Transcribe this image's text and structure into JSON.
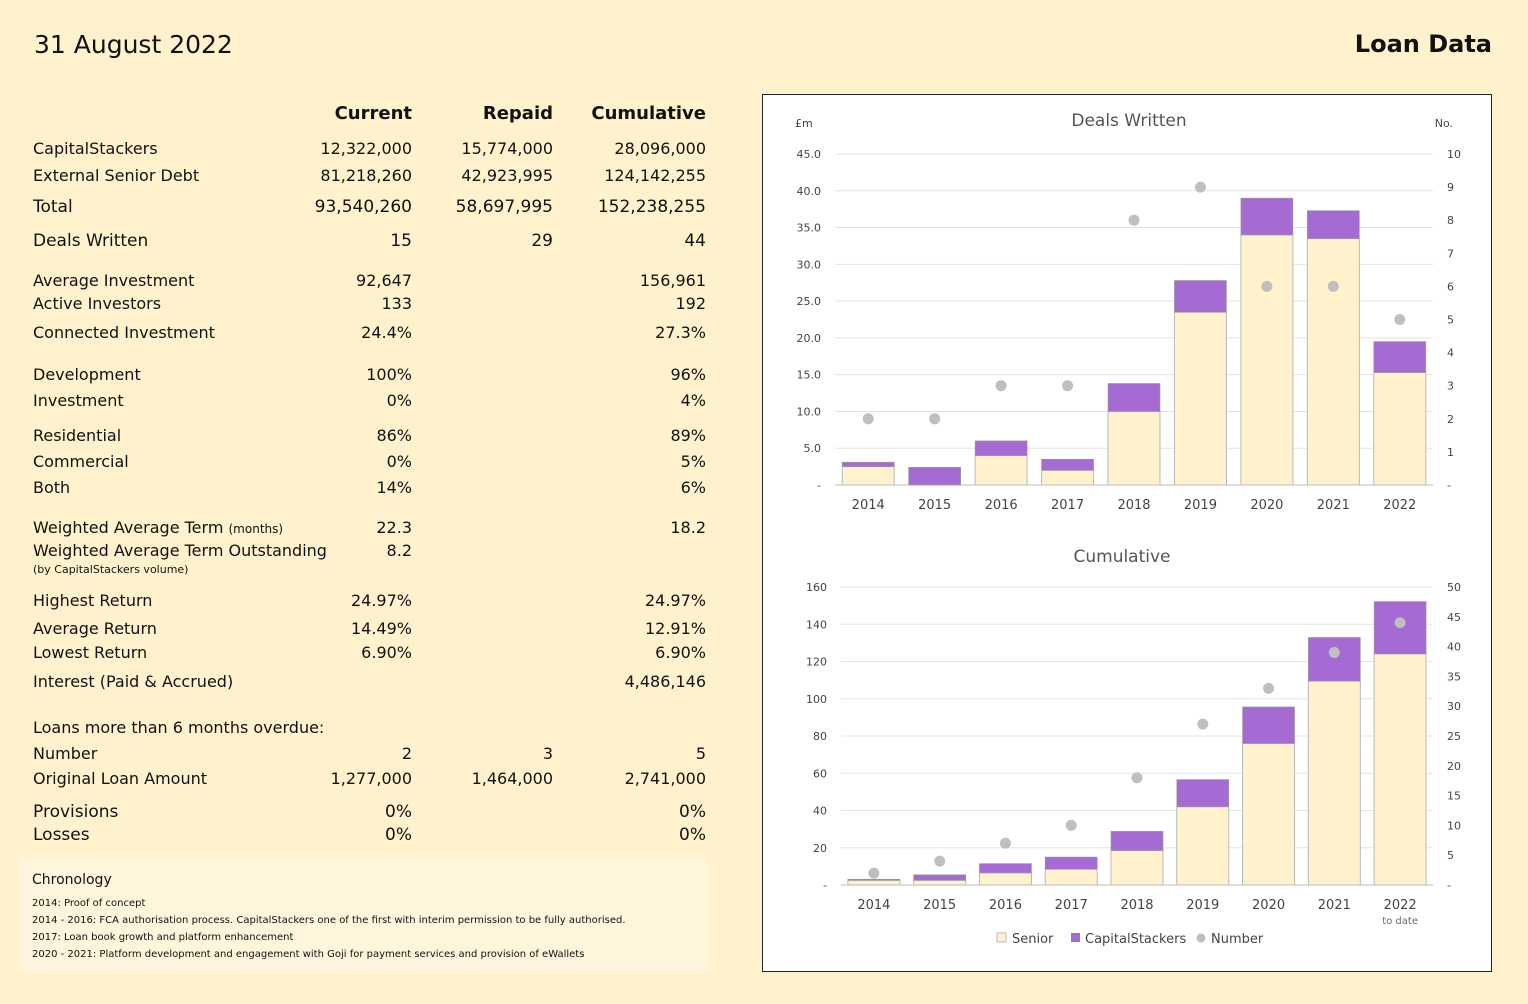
{
  "header": {
    "date": "31 August 2022",
    "title": "Loan Data"
  },
  "columns": {
    "current": "Current",
    "repaid": "Repaid",
    "cumulative": "Cumulative"
  },
  "rows": [
    {
      "label": "CapitalStackers",
      "current": "12,322,000",
      "repaid": "15,774,000",
      "cumulative": "28,096,000"
    },
    {
      "label": "External Senior Debt",
      "current": "81,218,260",
      "repaid": "42,923,995",
      "cumulative": "124,142,255"
    },
    {
      "label": "Total",
      "current": "93,540,260",
      "repaid": "58,697,995",
      "cumulative": "152,238,255"
    },
    {
      "label": "Deals Written",
      "current": "15",
      "repaid": "29",
      "cumulative": "44"
    },
    {
      "label": "Average Investment",
      "current": "92,647",
      "repaid": "",
      "cumulative": "156,961"
    },
    {
      "label": "Active Investors",
      "current": "133",
      "repaid": "",
      "cumulative": "192"
    },
    {
      "label": "Connected Investment",
      "current": "24.4%",
      "repaid": "",
      "cumulative": "27.3%"
    },
    {
      "label": "Development",
      "current": "100%",
      "repaid": "",
      "cumulative": "96%"
    },
    {
      "label": "Investment",
      "current": "0%",
      "repaid": "",
      "cumulative": "4%"
    },
    {
      "label": "Residential",
      "current": "86%",
      "repaid": "",
      "cumulative": "89%"
    },
    {
      "label": "Commercial",
      "current": "0%",
      "repaid": "",
      "cumulative": "5%"
    },
    {
      "label": "Both",
      "current": "14%",
      "repaid": "",
      "cumulative": "6%"
    },
    {
      "label": "Weighted Average Term",
      "label_small": "(months)",
      "current": "22.3",
      "repaid": "",
      "cumulative": "18.2"
    },
    {
      "label": "Weighted Average Term Outstanding",
      "note": "(by CapitalStackers volume)",
      "current": "8.2",
      "repaid": "",
      "cumulative": ""
    },
    {
      "label": "Highest Return",
      "current": "24.97%",
      "repaid": "",
      "cumulative": "24.97%"
    },
    {
      "label": "Average Return",
      "current": "14.49%",
      "repaid": "",
      "cumulative": "12.91%"
    },
    {
      "label": "Lowest Return",
      "current": "6.90%",
      "repaid": "",
      "cumulative": "6.90%"
    },
    {
      "label": "Interest (Paid & Accrued)",
      "current": "",
      "repaid": "",
      "cumulative": "4,486,146"
    },
    {
      "label": "Loans more than 6 months overdue:",
      "current": "",
      "repaid": "",
      "cumulative": ""
    },
    {
      "label": "Number",
      "current": "2",
      "repaid": "3",
      "cumulative": "5"
    },
    {
      "label": "Original Loan Amount",
      "current": "1,277,000",
      "repaid": "1,464,000",
      "cumulative": "2,741,000"
    },
    {
      "label": "Provisions",
      "current": "0%",
      "repaid": "",
      "cumulative": "0%"
    },
    {
      "label": "Losses",
      "current": "0%",
      "repaid": "",
      "cumulative": "0%"
    }
  ],
  "chronology": {
    "title": "Chronology",
    "lines": [
      "2014:  Proof of concept",
      "2014 - 2016:  FCA authorisation process.  CapitalStackers one of the first with interim permission to be fully authorised.",
      "2017:  Loan book growth and platform enhancement",
      "2020 - 2021:  Platform development and engagement with Goji for payment services and provision of eWallets"
    ]
  },
  "colors": {
    "senior": "#fff2cc",
    "capitalstackers": "#a66bd3",
    "number": "#bfbfbf",
    "background": "#fff2cc"
  },
  "chart_data": [
    {
      "type": "bar",
      "stacked": true,
      "title": "Deals Written",
      "ylabel": "£m",
      "y2label": "No.",
      "categories": [
        "2014",
        "2015",
        "2016",
        "2017",
        "2018",
        "2019",
        "2020",
        "2021",
        "2022"
      ],
      "category_sub": [
        "",
        "",
        "",
        "",
        "",
        "",
        "",
        "",
        ""
      ],
      "ylim": [
        0,
        45
      ],
      "y_ticks": [
        "-",
        "5.0",
        "10.0",
        "15.0",
        "20.0",
        "25.0",
        "30.0",
        "35.0",
        "40.0",
        "45.0"
      ],
      "y2lim": [
        0,
        10
      ],
      "y2_ticks": [
        "-",
        "1",
        "2",
        "3",
        "4",
        "5",
        "6",
        "7",
        "8",
        "9",
        "10"
      ],
      "series": [
        {
          "name": "Senior",
          "values": [
            2.5,
            0,
            4,
            2,
            10,
            23.5,
            34,
            33.5,
            15.3
          ]
        },
        {
          "name": "CapitalStackers",
          "values": [
            0.6,
            2.4,
            2,
            1.5,
            3.8,
            4.3,
            5,
            3.8,
            4.2
          ]
        }
      ],
      "secondary": {
        "name": "Number",
        "type": "scatter",
        "values": [
          2,
          2,
          3,
          3,
          8,
          9,
          6,
          6,
          5
        ]
      }
    },
    {
      "type": "bar",
      "stacked": true,
      "title": "Cumulative",
      "categories": [
        "2014",
        "2015",
        "2016",
        "2017",
        "2018",
        "2019",
        "2020",
        "2021",
        "2022"
      ],
      "category_sub": [
        "",
        "",
        "",
        "",
        "",
        "",
        "",
        "",
        "to date"
      ],
      "ylim": [
        0,
        160
      ],
      "y_ticks": [
        "-",
        "20",
        "40",
        "60",
        "80",
        "100",
        "120",
        "140",
        "160"
      ],
      "y2lim": [
        0,
        50
      ],
      "y2_ticks": [
        "-",
        "5",
        "10",
        "15",
        "20",
        "25",
        "30",
        "35",
        "40",
        "45",
        "50"
      ],
      "series": [
        {
          "name": "Senior",
          "values": [
            2.5,
            2.5,
            6.5,
            8.5,
            18.5,
            42,
            76,
            109.5,
            124.1
          ]
        },
        {
          "name": "CapitalStackers",
          "values": [
            0.6,
            3,
            5,
            6.5,
            10.3,
            14.6,
            19.6,
            23.4,
            28.1
          ]
        }
      ],
      "secondary": {
        "name": "Number",
        "type": "scatter",
        "values": [
          2,
          4,
          7,
          10,
          18,
          27,
          33,
          39,
          44
        ]
      }
    }
  ],
  "legend": [
    "Senior",
    "CapitalStackers",
    "Number"
  ]
}
